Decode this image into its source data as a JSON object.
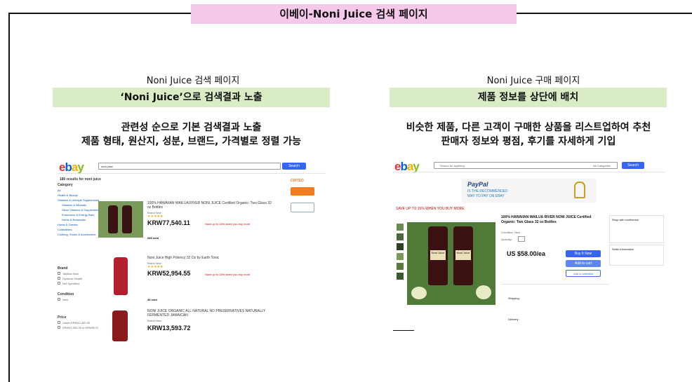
{
  "page_title": "이베이-Noni Juice 검색 페이지",
  "left": {
    "heading": "Noni Juice 검색 페이지",
    "bar": "‘Noni Juice’으로 검색결과 노출",
    "desc_lines": [
      "관련성 순으로 기본 검색결과 노출",
      "제품 형태, 원산지, 성분, 브랜드, 가격별로 정렬 가능"
    ],
    "shot": {
      "search_value": "noni juice",
      "search_button": "Search",
      "results_count": "180 results for noni juice",
      "sidebar_title": "Category",
      "sidebar_items": [
        "All",
        "Health & Beauty",
        "Vitamins & Lifestyle Supplements",
        "Vitamins & Minerals",
        "Other Vitamins & Supplements",
        "Endurance & Energy Bars",
        "Herbs & Botanicals",
        "Home & Garden",
        "Collectibles",
        "Clothing, Shoes & Accessories"
      ],
      "sidebar_brand": "Brand",
      "sidebar_brand_items": [
        "Tahitian Noni",
        "Dynamic Health",
        "Not Specified"
      ],
      "sidebar_condition": "Condition",
      "sidebar_condition_items": [
        "New"
      ],
      "sidebar_price": "Price",
      "sidebar_price_items": [
        "Under KRW42,300.00",
        "KRW42,300.00 to KRW95,207.00"
      ],
      "criteo": "CRITEO",
      "items": [
        {
          "title": "100% HAWAIIAN WAILUA RIVER NONI JUICE Certified Organic: Two Glass 32 oz Bottles",
          "sub": "Brand New",
          "price": "KRW77,540.11",
          "promo": "Save up to 15% when you buy more",
          "sold": "685 sold"
        },
        {
          "title": "Noni Juice High Potency 32 Oz by Earth Tonic",
          "sub": "Brand New",
          "price": "KRW52,954.55",
          "promo": "Save up to 15% when you buy more",
          "sold": "38 sold"
        },
        {
          "title": "NONI JUICE ORGANIC ALL NATURAL NO PRESERVATIVES NATURALLY FERMENTED JAMAICAN",
          "sub": "Brand New",
          "price": "KRW13,593.72",
          "promo": "",
          "sold": ""
        }
      ]
    }
  },
  "right": {
    "heading": "Noni Juice 구매 페이지",
    "bar": "제품 정보를 상단에 배치",
    "desc_lines": [
      "비슷한 제품, 다른 고객이 구매한 상품을 리스트업하여 추천",
      "판매자 정보와 평점, 후기를 자세하게 기입"
    ],
    "shot": {
      "search_placeholder": "Search for anything",
      "category": "All Categories",
      "search_button": "Search",
      "paypal_brand": "PayPal",
      "paypal_line1": "IS THE RECOMMENDED",
      "paypal_line2": "WAY TO PAY ON EBAY",
      "promo": "SAVE UP TO 15% WHEN YOU BUY MORE",
      "bottle_label": "Noni Juice",
      "product_title": "100% HAWAIIAN WAILUA RIVER NONI JUICE Certified Organic: Two Glass 32 oz Bottles",
      "condition": "Condition: New",
      "quantity": "Quantity:",
      "price": "US $58.00/ea",
      "buy_now": "Buy It Now",
      "add_cart": "Add to cart",
      "watchlist": "Add to watchlist",
      "seller_title": "Shop with confidence",
      "seller_info": "Seller information",
      "shipping": "Shipping:",
      "delivery": "Delivery:"
    }
  },
  "colors": {
    "accent_pink": "#f6c8ea",
    "bar_green": "#d9ecc6",
    "ebay_blue": "#3665f3"
  }
}
